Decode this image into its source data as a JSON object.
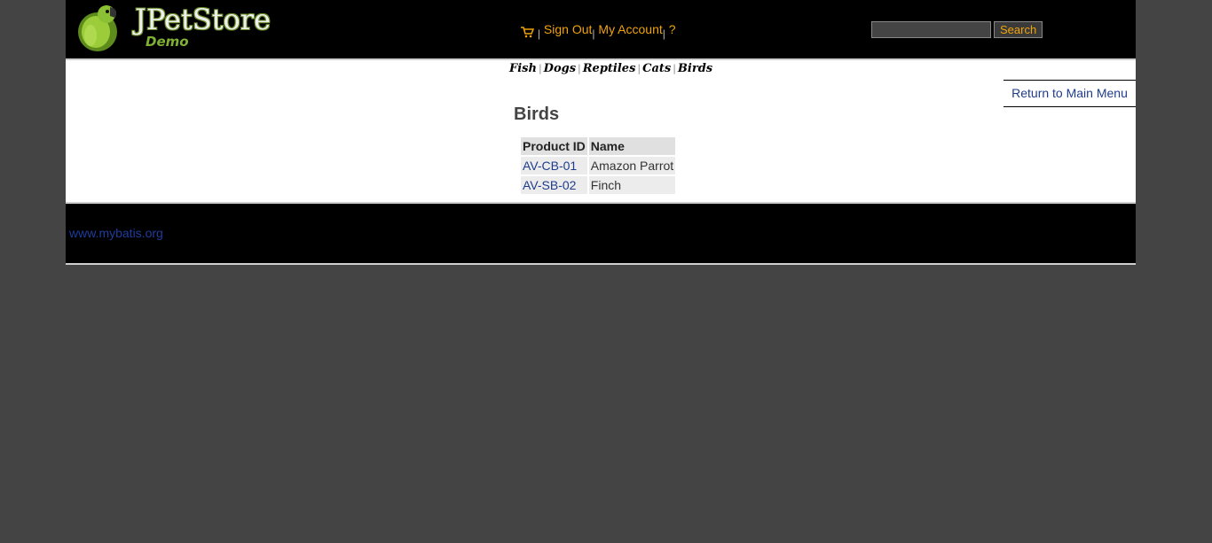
{
  "header": {
    "brand": "JPetStore",
    "subtitle": "Demo",
    "menu": {
      "cart_icon": "shopping-cart-icon",
      "sign_out": "Sign Out",
      "my_account": "My Account",
      "help": "?",
      "separator": "|"
    },
    "search": {
      "value": "",
      "button_label": "Search"
    }
  },
  "quicklinks": [
    "Fish",
    "Dogs",
    "Reptiles",
    "Cats",
    "Birds"
  ],
  "back_link": "Return to Main Menu",
  "category": {
    "title": "Birds",
    "columns": [
      "Product ID",
      "Name"
    ],
    "rows": [
      {
        "id": "AV-CB-01",
        "name": "Amazon Parrot"
      },
      {
        "id": "AV-SB-02",
        "name": "Finch"
      }
    ]
  },
  "footer": {
    "link": "www.mybatis.org"
  },
  "colors": {
    "page_bg": "#444444",
    "header_bg": "#000000",
    "menu_link": "#f0a30a",
    "link": "#1f3c8c"
  }
}
